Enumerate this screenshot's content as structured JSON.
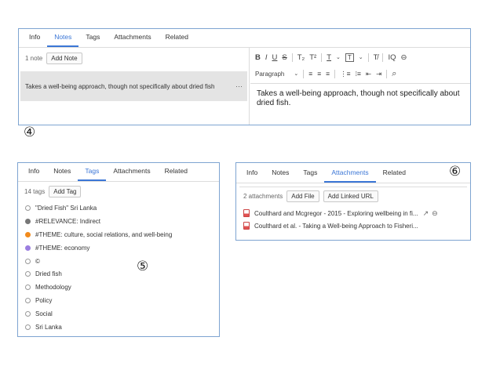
{
  "panel4": {
    "tabs": [
      "Info",
      "Notes",
      "Tags",
      "Attachments",
      "Related"
    ],
    "note_count": "1 note",
    "add_note_label": "Add Note",
    "note_preview": "Takes a well-being approach, though not specifically about dried fish",
    "note_menu": "···",
    "callout": "④",
    "toolbar": {
      "bold": "B",
      "italic": "I",
      "underline": "U",
      "strike": "S",
      "subscript": "T₂",
      "superscript": "T²",
      "text_color": "T",
      "highlight": "T",
      "clear_format": "T̸",
      "insert_citation": "IQ",
      "link": "⊖",
      "paragraph_format": "Paragraph",
      "chev": "⌄",
      "align_left": "≡",
      "align_center": "≡",
      "align_right": "≡",
      "bulleted_list": "⋮≡",
      "numbered_list": "⁞≡",
      "outdent": "⇤",
      "indent": "⇥",
      "find": "⌕"
    },
    "editor_text": "Takes a well-being approach, though not specifically about dried fish."
  },
  "panel5": {
    "tabs": [
      "Info",
      "Notes",
      "Tags",
      "Attachments",
      "Related"
    ],
    "tag_count": "14 tags",
    "add_tag_label": "Add Tag",
    "callout": "⑤",
    "tags": [
      {
        "label": "\"Dried Fish\" Sri Lanka",
        "color": ""
      },
      {
        "label": "#RELEVANCE: Indirect",
        "color": "#777777"
      },
      {
        "label": "#THEME: culture, social relations, and well-being",
        "color": "#f28b1c"
      },
      {
        "label": "#THEME: economy",
        "color": "#9b7ee0"
      },
      {
        "label": "©",
        "color": ""
      },
      {
        "label": "Dried fish",
        "color": ""
      },
      {
        "label": "Methodology",
        "color": ""
      },
      {
        "label": "Policy",
        "color": ""
      },
      {
        "label": "Social",
        "color": ""
      },
      {
        "label": "Sri Lanka",
        "color": ""
      }
    ]
  },
  "panel6": {
    "tabs": [
      "Info",
      "Notes",
      "Tags",
      "Attachments",
      "Related"
    ],
    "attachment_count": "2 attachments",
    "add_file_label": "Add File",
    "add_linked_url_label": "Add Linked URL",
    "callout": "⑥",
    "attachments": [
      {
        "label": "Coulthard and Mcgregor - 2015 - Exploring wellbeing in fi...",
        "show_icon": "↗",
        "remove_icon": "⊖"
      },
      {
        "label": "Coulthard et al. - Taking a Well-being Approach to Fisheri..."
      }
    ]
  }
}
